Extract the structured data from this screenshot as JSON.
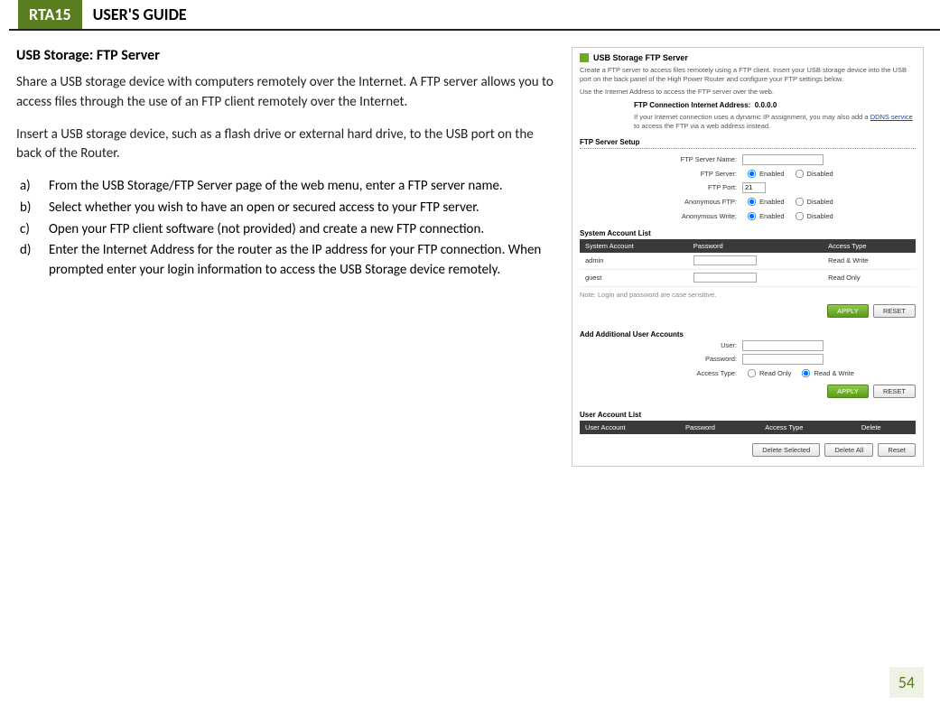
{
  "header": {
    "badge": "RTA15",
    "title": "USER'S GUIDE"
  },
  "left": {
    "section_title": "USB Storage: FTP Server",
    "p1": "Share a USB storage device with computers remotely over the Internet.  A FTP server allows you to access files through the use of an FTP client remotely over the Internet.",
    "p2": "Insert a USB storage device, such as a flash drive or external hard drive, to the USB port on the back of the Router.",
    "steps": {
      "a": "From the USB Storage/FTP Server page of the web menu, enter a FTP server name.",
      "b": "Select whether you wish to have an open or secured access to your FTP server.",
      "c": "Open your FTP client software (not provided) and create a new FTP connection.",
      "d": "Enter the Internet Address for the router as the IP address for your FTP connection.  When prompted enter your login information to access the USB Storage device remotely."
    }
  },
  "panel": {
    "title": "USB Storage FTP Server",
    "desc1": "Create a FTP server to access files remotely using a FTP client. Insert your USB storage device into the USB port on the back panel of the High Power Router and configure your FTP settings below.",
    "desc2": "Use the Internet Address to access the FTP server over the web.",
    "conn_label": "FTP Connection Internet Address:",
    "conn_value": "0.0.0.0",
    "note_pre": "If your Internet connection uses a dynamic IP assignment, you may also add a ",
    "note_link": "DDNS service",
    "note_post": " to access the FTP via a web address instead.",
    "setup_label": "FTP Server Setup",
    "labels": {
      "server_name": "FTP Server Name:",
      "server": "FTP Server:",
      "port": "FTP Port:",
      "anon_ftp": "Anonymous FTP:",
      "anon_write": "Anonymous Write:",
      "enabled": "Enabled",
      "disabled": "Disabled",
      "port_value": "21"
    },
    "sys_list_label": "System Account List",
    "sys_headers": {
      "acct": "System Account",
      "pwd": "Password",
      "access": "Access Type"
    },
    "sys_rows": [
      {
        "acct": "admin",
        "access": "Read & Write"
      },
      {
        "acct": "guest",
        "access": "Read Only"
      }
    ],
    "case_note": "Note: Login and password are case sensitive.",
    "btn_apply": "APPLY",
    "btn_reset": "RESET",
    "add_label": "Add Additional User Accounts",
    "add": {
      "user": "User:",
      "password": "Password:",
      "access_type": "Access Type:",
      "read_only": "Read Only",
      "read_write": "Read & Write"
    },
    "user_list_label": "User Account List",
    "user_headers": {
      "acct": "User Account",
      "pwd": "Password",
      "access": "Access Type",
      "del": "Delete"
    },
    "btn_del_sel": "Delete Selected",
    "btn_del_all": "Delete All",
    "btn_reset2": "Reset"
  },
  "page_number": "54"
}
